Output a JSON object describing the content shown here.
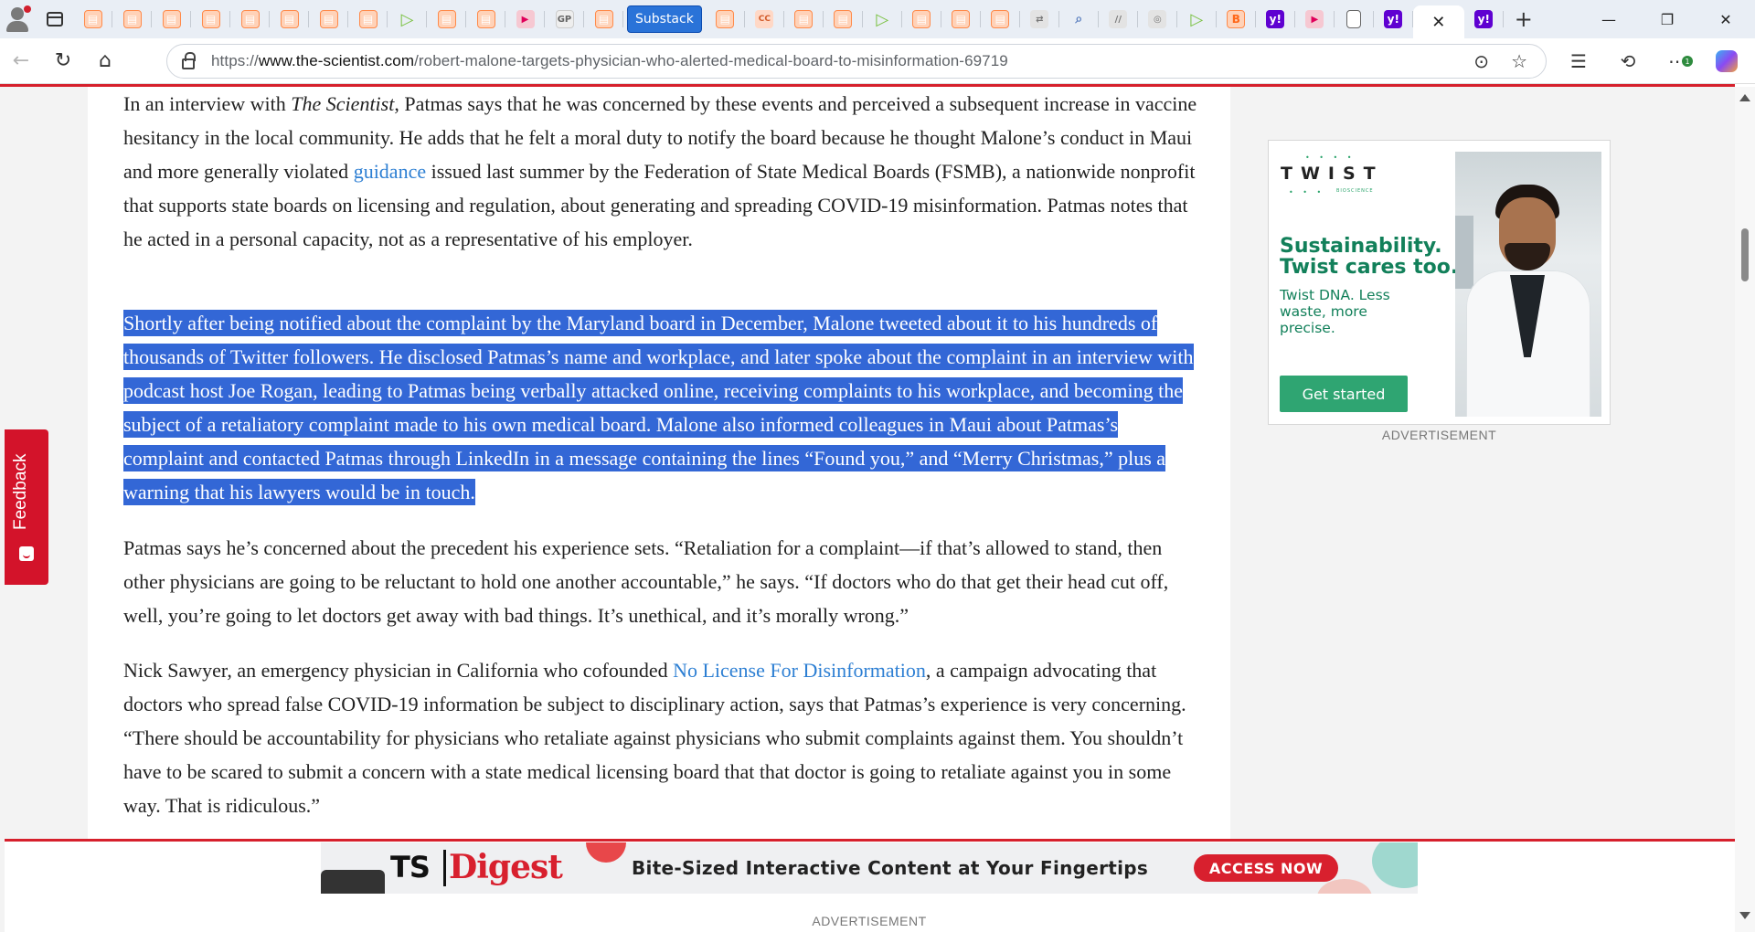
{
  "browser": {
    "tabs": [
      {
        "icon": "substack-icon"
      },
      {
        "icon": "substack-icon"
      },
      {
        "icon": "substack-icon"
      },
      {
        "icon": "substack-icon"
      },
      {
        "icon": "substack-icon"
      },
      {
        "icon": "substack-icon"
      },
      {
        "icon": "substack-icon"
      },
      {
        "icon": "substack-icon"
      },
      {
        "icon": "play-icon"
      },
      {
        "icon": "substack-icon"
      },
      {
        "icon": "substack-icon"
      },
      {
        "icon": "youtube-icon"
      },
      {
        "icon": "gp-icon",
        "text": "GP"
      },
      {
        "icon": "substack-icon"
      }
    ],
    "substack_tab_label": "Substack",
    "tabs_after": [
      {
        "icon": "substack-icon"
      },
      {
        "icon": "cc-icon",
        "text": "CC"
      },
      {
        "icon": "substack-icon"
      },
      {
        "icon": "substack-icon"
      },
      {
        "icon": "play-icon"
      },
      {
        "icon": "substack-icon"
      },
      {
        "icon": "substack-icon"
      },
      {
        "icon": "substack-icon"
      },
      {
        "icon": "translate-icon"
      },
      {
        "icon": "search-icon"
      },
      {
        "icon": "slash-icon"
      },
      {
        "icon": "robot-icon"
      },
      {
        "icon": "play-icon"
      },
      {
        "icon": "b-icon",
        "text": "B"
      },
      {
        "icon": "yahoo-icon",
        "text": "y!"
      },
      {
        "icon": "youtube-icon"
      },
      {
        "icon": "document-icon"
      },
      {
        "icon": "yahoo-icon",
        "text": "y!"
      }
    ],
    "active_tab_close": "✕",
    "last_tab": {
      "icon": "yahoo-icon",
      "text": "y!"
    },
    "new_tab": "+",
    "window_controls": {
      "minimize": "—",
      "restore": "❐",
      "close": "✕"
    },
    "url_scheme": "https://",
    "url_host": "www.the-scientist.com",
    "url_path": "/robert-malone-targets-physician-who-alerted-medical-board-to-misinformation-69719",
    "extension_badge": "1"
  },
  "article": {
    "p1_part1": "In an interview with ",
    "p1_em": "The Scientist",
    "p1_part2": ", Patmas says that he was concerned by these events and perceived a subsequent increase in vaccine hesitancy in the local community. He adds that he felt a moral duty to notify the board because he thought Malone’s conduct in Maui and more generally violated ",
    "p1_link": "guidance",
    "p1_part3": " issued last summer by the Federation of State Medical Boards (FSMB), a nationwide nonprofit that supports state boards on licensing and regulation, about generating and spreading COVID-19 misinformation. Patmas notes that he acted in a personal capacity, not as a representative of his employer.",
    "p2": "Shortly after being notified about the complaint by the Maryland board in December, Malone tweeted about it to his hundreds of thousands of Twitter followers. He disclosed Patmas’s name and workplace, and later spoke about the complaint in an interview with podcast host Joe Rogan, leading to Patmas being verbally attacked online, receiving complaints to his workplace, and becoming the subject of a retaliatory complaint made to his own medical board. Malone also informed colleagues in Maui about Patmas’s complaint and contacted Patmas through LinkedIn in a message containing the lines “Found you,” and “Merry Christmas,” plus a warning that his lawyers would be in touch.",
    "p3": "Patmas says he’s concerned about the precedent his experience sets. “Retaliation for a complaint—if that’s allowed to stand, then other physicians are going to be reluctant to hold one another accountable,” he says. “If doctors who do that get their head cut off, well, you’re going to let doctors get away with bad things. It’s unethical, and it’s morally wrong.”",
    "p4_part1": "Nick Sawyer, an emergency physician in California who cofounded ",
    "p4_link": "No License For Disinformation",
    "p4_part2": ", a campaign advocating that doctors who spread false COVID-19 information be subject to disciplinary action, says that Patmas’s experience is very concerning. “There should be accountability for physicians who retaliate against physicians who submit complaints against them. You shouldn’t have to be scared to submit a concern with a state medical licensing board that that doctor is going to retaliate against you in some way. That is ridiculous.”"
  },
  "side_ad": {
    "brand": "TWIST",
    "brand_sub": "BIOSCIENCE",
    "headline": "Sustainability. Twist cares too.",
    "body": "Twist DNA. Less waste, more precise.",
    "cta": "Get started",
    "label": "ADVERTISEMENT"
  },
  "feedback": {
    "label": "Feedback"
  },
  "bottom_ad": {
    "logo_ts": "TS",
    "logo_digest": "Digest",
    "tagline": "Bite-Sized Interactive Content at Your Fingertips",
    "cta": "ACCESS NOW",
    "label": "ADVERTISEMENT"
  },
  "colors": {
    "accent_red": "#d6202c",
    "selection": "#3367d6",
    "link": "#2d7fd3",
    "twist_green": "#12805a"
  }
}
